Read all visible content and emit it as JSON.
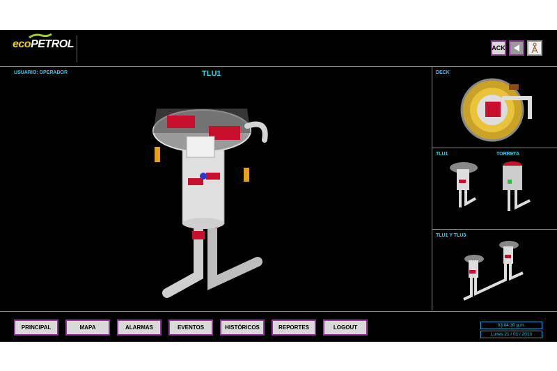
{
  "header": {
    "logo_part1": "eco",
    "logo_part2": "PETROL",
    "ack_label": "ACK",
    "back_icon": "triangle-left-icon",
    "tower_icon": "antenna-tower-icon"
  },
  "main": {
    "user_label": "USUARIO: OPERADOR",
    "title": "TLU1"
  },
  "side": {
    "deck_label": "DECK",
    "tlu1_label": "TLU1",
    "torreta_label": "TORRETA",
    "tlu1_tlu3_label": "TLU1 Y TLU3"
  },
  "nav": {
    "items": [
      "PRINCIPAL",
      "MAPA",
      "ALARMAS",
      "EVENTOS",
      "HISTÓRICOS",
      "REPORTES",
      "LOGOUT"
    ]
  },
  "status": {
    "time": "03:04:30 p.m.",
    "date": "Lunes 21 / 01 / 2013"
  },
  "colors": {
    "accent_text": "#2ad4f0",
    "button_border": "#8d3b94",
    "button_fill": "#d9d9d9",
    "equipment_red": "#c8102e"
  }
}
